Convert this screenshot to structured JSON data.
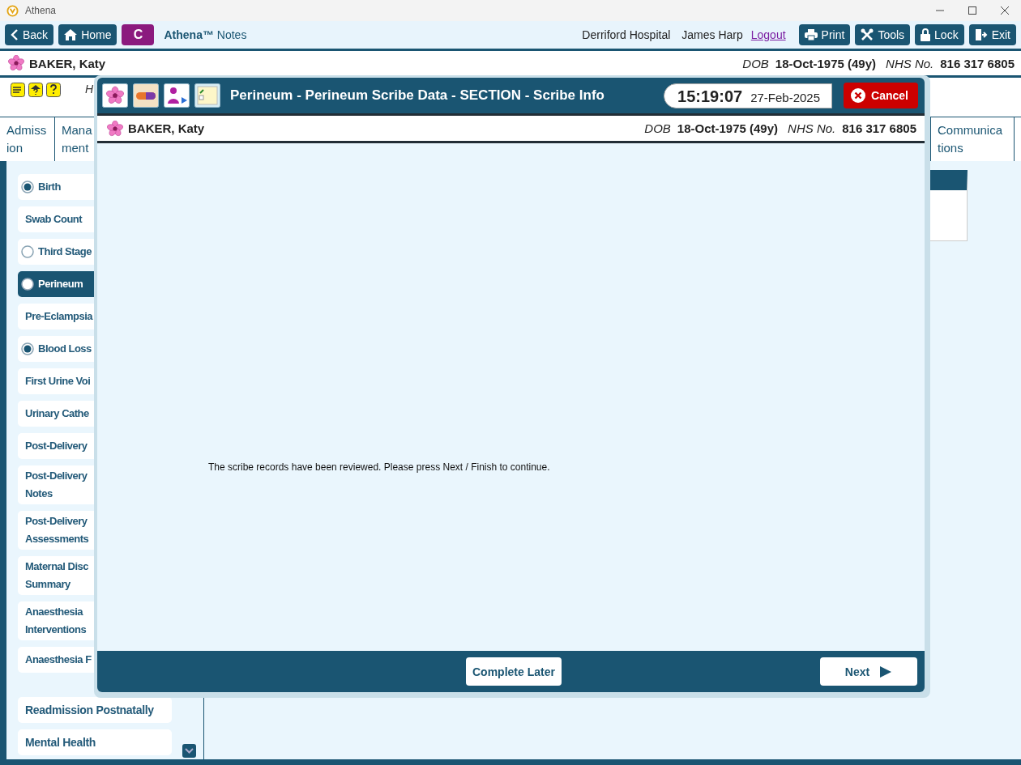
{
  "window": {
    "title": "Athena"
  },
  "toolbar": {
    "left_buttons": [
      {
        "label": "Back"
      },
      {
        "label": "Home"
      }
    ],
    "app_badge": "C",
    "app_name": "Athena™",
    "app_suffix": "Notes",
    "hospital": "Derriford Hospital",
    "user": "James Harp",
    "logout": "Logout",
    "right_buttons": [
      {
        "label": "Print"
      },
      {
        "label": "Tools"
      },
      {
        "label": "Lock"
      },
      {
        "label": "Exit"
      }
    ]
  },
  "patient": {
    "name": "BAKER, Katy",
    "dob_label": "DOB",
    "dob": "18-Oct-1975 (49y)",
    "nhs_label": "NHS No.",
    "nhs": "816 317 6805"
  },
  "header_text": "H",
  "tabs": [
    {
      "lines": [
        "Admiss",
        "ion"
      ]
    },
    {
      "lines": [
        "Mana",
        "ment"
      ]
    },
    {
      "lines": [
        "Communica",
        "tions"
      ]
    }
  ],
  "sidebar": {
    "groups": [
      [
        {
          "label": "Birth",
          "kind": "radio",
          "checked": true,
          "selected": false
        },
        {
          "label": "Swab Count",
          "kind": "plain",
          "selected": false
        },
        {
          "label": "Third Stage",
          "kind": "radio",
          "checked": false,
          "selected": false
        },
        {
          "label": "Perineum",
          "kind": "radio",
          "checked": false,
          "selected": true
        },
        {
          "label": "Pre-Eclampsia",
          "kind": "plain",
          "selected": false
        },
        {
          "label": "Blood Loss",
          "kind": "radio",
          "checked": true,
          "selected": false
        },
        {
          "label": "First Urine Voi",
          "kind": "plain",
          "selected": false
        },
        {
          "label": "Urinary Cathe",
          "kind": "plain",
          "selected": false
        },
        {
          "label": "Post-Delivery",
          "kind": "plain",
          "selected": false
        },
        {
          "label": "Post-Delivery Notes",
          "kind": "plain",
          "selected": false
        },
        {
          "label": "Post-Delivery Assessments",
          "kind": "plain",
          "selected": false
        },
        {
          "label": "Maternal Disc Summary",
          "kind": "plain",
          "selected": false
        },
        {
          "label": "Anaesthesia Interventions",
          "kind": "plain",
          "selected": false
        },
        {
          "label": "Anaesthesia F",
          "kind": "plain",
          "selected": false
        }
      ],
      [
        {
          "label": "Readmission Postnatally",
          "kind": "plain",
          "selected": false
        },
        {
          "label": "Mental Health",
          "kind": "plain",
          "selected": false
        }
      ]
    ]
  },
  "modal": {
    "title": "Perineum - Perineum Scribe Data - SECTION - Scribe Info",
    "time": "15:19:07",
    "date": "27-Feb-2025",
    "cancel": "Cancel",
    "patient": {
      "name": "BAKER, Katy",
      "dob_label": "DOB",
      "dob": "18-Oct-1975 (49y)",
      "nhs_label": "NHS No.",
      "nhs": "816 317 6805"
    },
    "message": "The scribe records have been reviewed. Please press Next / Finish to continue.",
    "buttons": [
      {
        "label": "Complete Later",
        "kind": "plain"
      },
      {
        "label": "Next",
        "kind": "next"
      }
    ]
  }
}
